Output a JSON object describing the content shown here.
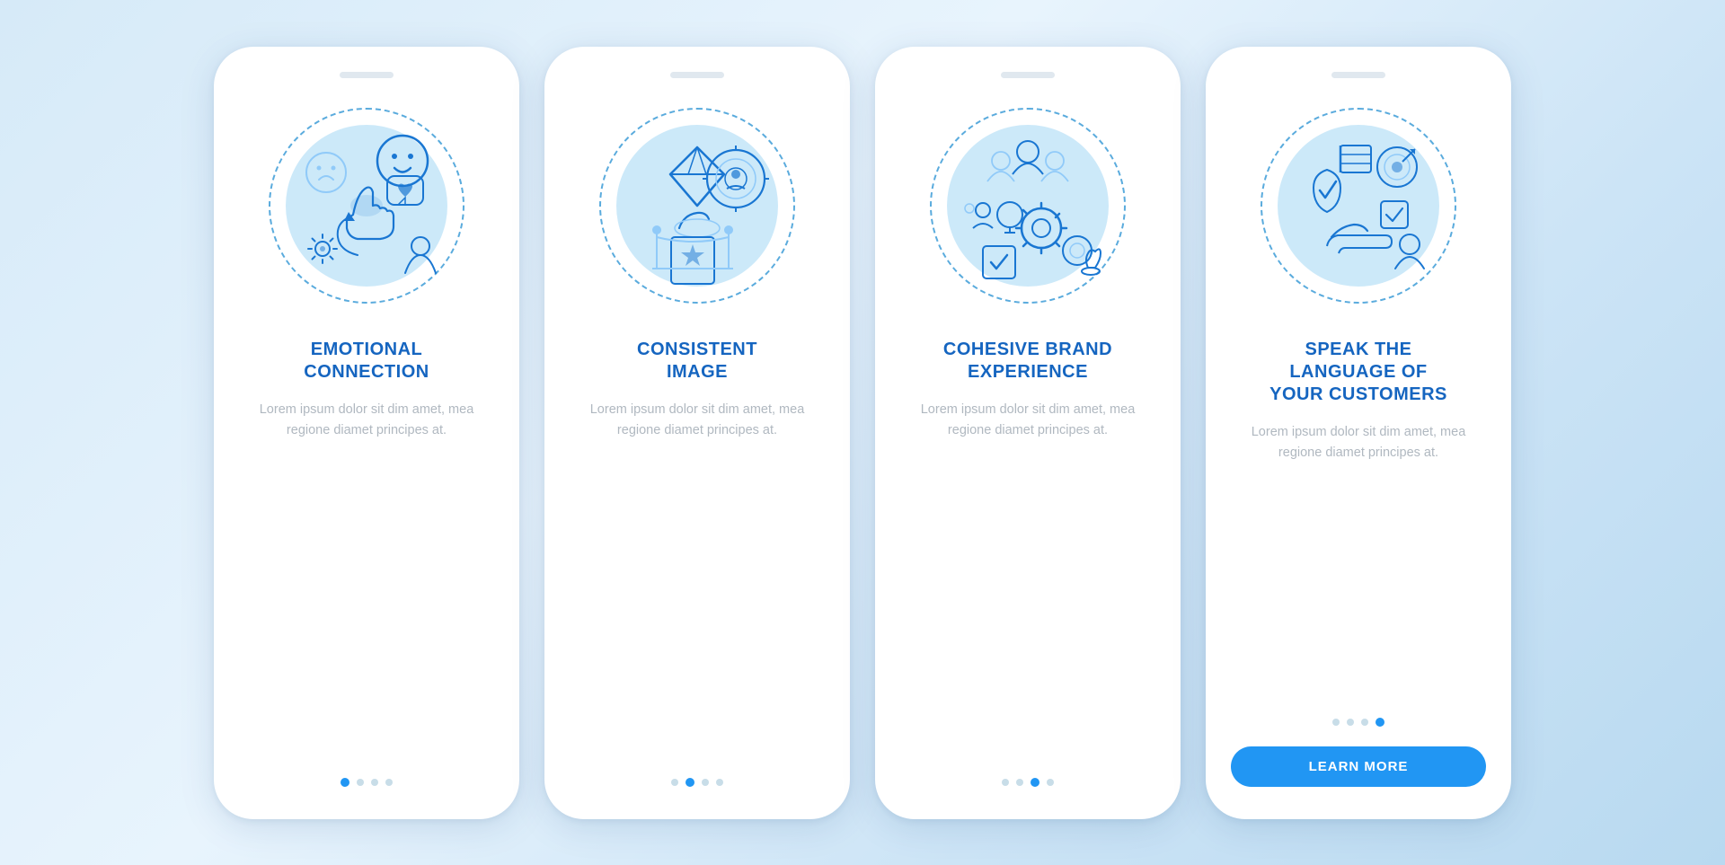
{
  "cards": [
    {
      "id": "emotional-connection",
      "title": "EMOTIONAL\nCONNECTION",
      "body": "Lorem ipsum dolor sit dim amet, mea regione diamet principes at.",
      "dots": [
        true,
        false,
        false,
        false
      ],
      "activeDot": 0,
      "hasButton": false,
      "buttonLabel": ""
    },
    {
      "id": "consistent-image",
      "title": "CONSISTENT\nIMAGE",
      "body": "Lorem ipsum dolor sit dim amet, mea regione diamet principes at.",
      "dots": [
        false,
        true,
        false,
        false
      ],
      "activeDot": 1,
      "hasButton": false,
      "buttonLabel": ""
    },
    {
      "id": "cohesive-brand",
      "title": "COHESIVE BRAND\nEXPERIENCE",
      "body": "Lorem ipsum dolor sit dim amet, mea regione diamet principes at.",
      "dots": [
        false,
        false,
        true,
        false
      ],
      "activeDot": 2,
      "hasButton": false,
      "buttonLabel": ""
    },
    {
      "id": "speak-language",
      "title": "SPEAK THE\nLANGUAGE OF\nYOUR CUSTOMERS",
      "body": "Lorem ipsum dolor sit dim amet, mea regione diamet principes at.",
      "dots": [
        false,
        false,
        false,
        true
      ],
      "activeDot": 3,
      "hasButton": true,
      "buttonLabel": "LEARN MORE"
    }
  ],
  "colors": {
    "accent": "#2196f3",
    "title": "#1565c0",
    "body": "#b0b8c0",
    "dotInactive": "#c8dde8",
    "dotActive": "#2196f3",
    "circleBg": "#cce9f9",
    "dashedBorder": "#5aabdd"
  }
}
